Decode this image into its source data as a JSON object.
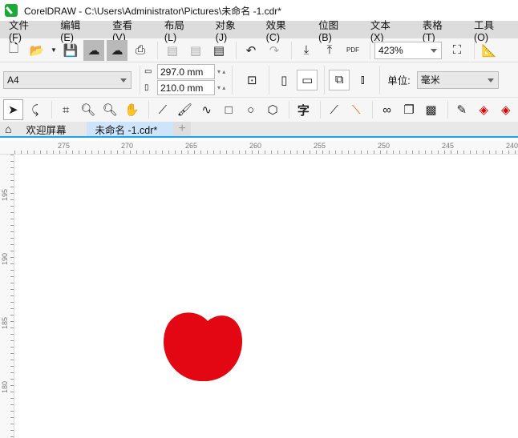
{
  "window": {
    "title": "CorelDRAW - C:\\Users\\Administrator\\Pictures\\未命名 -1.cdr*"
  },
  "menu": [
    "文件(F)",
    "编辑(E)",
    "查看(V)",
    "布局(L)",
    "对象(J)",
    "效果(C)",
    "位图(B)",
    "文本(X)",
    "表格(T)",
    "工具(O)"
  ],
  "toolbar": {
    "zoom": "423%",
    "pdf_label": "PDF"
  },
  "property_bar": {
    "page_size": "A4",
    "width": "297.0 mm",
    "height": "210.0 mm",
    "units_label": "单位:",
    "units": "毫米"
  },
  "tabs": [
    {
      "label": "欢迎屏幕"
    },
    {
      "label": "未命名 -1.cdr*",
      "active": true
    }
  ],
  "ruler": {
    "horizontal": [
      "275",
      "270",
      "265",
      "260",
      "255",
      "250",
      "245",
      "240"
    ],
    "vertical": [
      "195",
      "190",
      "185",
      "180"
    ]
  },
  "canvas": {
    "shape_color": "#e30613"
  },
  "colors": {
    "accent": "#1aa3f0",
    "tab_active": "#cde4fb"
  }
}
